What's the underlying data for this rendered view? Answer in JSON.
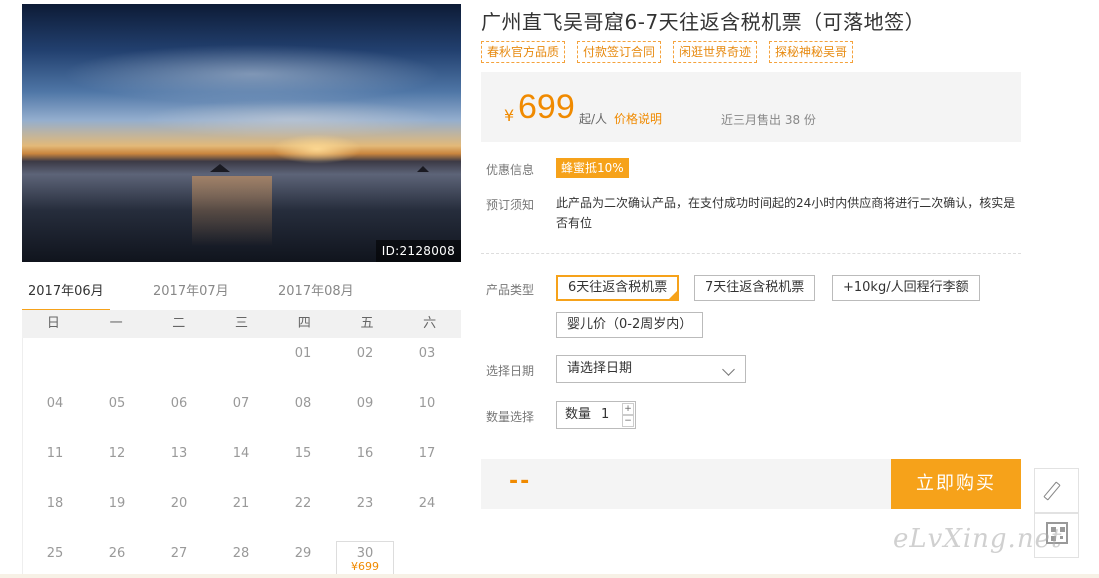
{
  "product": {
    "title": "广州直飞吴哥窟6-7天往返含税机票（可落地签）",
    "image_id": "ID:2128008",
    "tags": [
      "春秋官方品质",
      "付款签订合同",
      "闲逛世界奇迹",
      "探秘神秘吴哥"
    ]
  },
  "price": {
    "currency": "¥",
    "amount": "699",
    "unit": "起/人",
    "explain_link": "价格说明",
    "sold": "近三月售出 38 份"
  },
  "discount": {
    "label": "优惠信息",
    "badge": "蜂蜜抵10%"
  },
  "notice": {
    "label": "预订须知",
    "text": "此产品为二次确认产品，在支付成功时间起的24小时内供应商将进行二次确认，核实是否有位"
  },
  "product_type": {
    "label": "产品类型",
    "options": [
      "6天往返含税机票",
      "7天往返含税机票",
      "+10kg/人回程行李额",
      "婴儿价（0-2周岁内）"
    ],
    "selected_index": 0
  },
  "date_select": {
    "label": "选择日期",
    "placeholder": "请选择日期"
  },
  "quantity": {
    "label": "数量选择",
    "prefix": "数量",
    "value": "1",
    "plus": "+",
    "minus": "−"
  },
  "buy": {
    "total": "--",
    "button": "立即购买"
  },
  "calendar": {
    "months": [
      "2017年06月",
      "2017年07月",
      "2017年08月"
    ],
    "active_month_index": 0,
    "weekdays": [
      "日",
      "一",
      "二",
      "三",
      "四",
      "五",
      "六"
    ],
    "rows": [
      [
        "",
        "",
        "",
        "",
        "01",
        "02",
        "03"
      ],
      [
        "04",
        "05",
        "06",
        "07",
        "08",
        "09",
        "10"
      ],
      [
        "11",
        "12",
        "13",
        "14",
        "15",
        "16",
        "17"
      ],
      [
        "18",
        "19",
        "20",
        "21",
        "22",
        "23",
        "24"
      ],
      [
        "25",
        "26",
        "27",
        "28",
        "29",
        "30",
        ""
      ]
    ],
    "priced_day": {
      "day": "30",
      "price": "¥699"
    }
  },
  "watermark": "eLvXing.net",
  "icons": {
    "side_top": "pencil-icon",
    "side_bottom": "qrcode-icon",
    "select": "chevron-down-icon"
  },
  "colors": {
    "accent": "#f6a21a",
    "price": "#f08a00"
  }
}
